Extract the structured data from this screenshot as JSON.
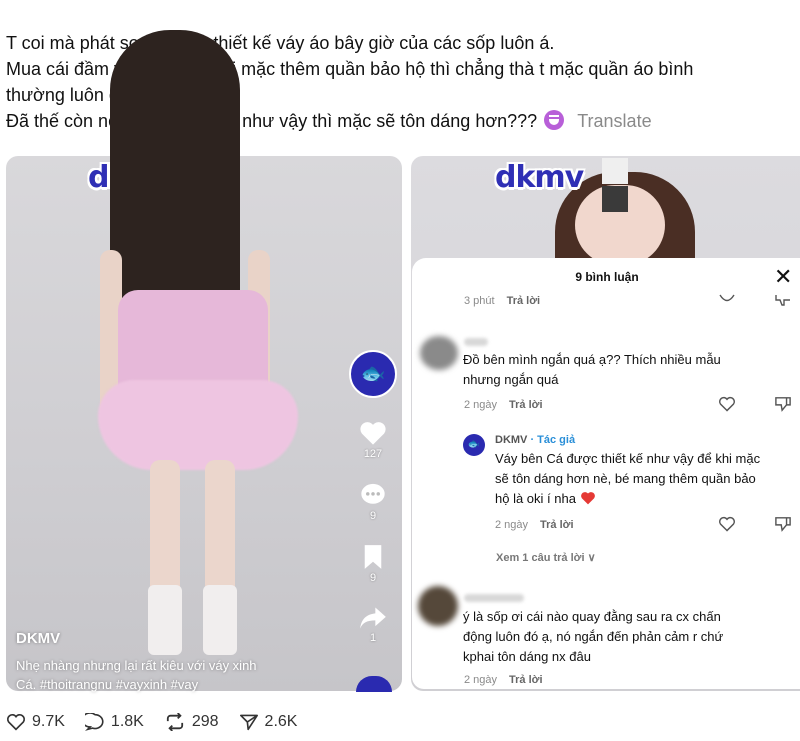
{
  "post": {
    "line1": "T coi mà phát sợ với kiểu thiết kế váy áo bây giờ của các sốp luôn á.",
    "line2": "Mua cái đầm về mà còn phải mặc thêm quần bảo hộ thì chẳng thà t mặc quần áo bình",
    "line3": "thường luôn cho xong.",
    "line4": "Đã thế còn nói là váy thiết kế như vậy thì mặc sẽ tôn dáng hơn???",
    "emoji": "laughing-purple-emoji",
    "translate": "Translate"
  },
  "left_video": {
    "logo": "dkmv",
    "likes": "127",
    "comments": "9",
    "saves": "9",
    "shares": "1",
    "author": "DKMV",
    "caption_line1": "Nhẹ nhàng nhưng lại rất kiêu với váy xinh",
    "caption_line2": "Cá. #thoitrangnu #vayxinh #vay"
  },
  "right_video": {
    "logo": "dkmv",
    "comments_title": "9 bình luận",
    "close": "✕",
    "comments": [
      {
        "time": "3 phút",
        "reply": "Trả lời"
      },
      {
        "text1": "Đồ bên mình ngắn quá ạ?? Thích nhiều mẫu",
        "text2": "nhưng ngắn quá",
        "time": "2 ngày",
        "reply": "Trả lời"
      },
      {
        "author": "DKMV",
        "author_tag": " · Tác giả",
        "text1": "Váy bên Cá được thiết kế như vậy để khi mặc",
        "text2": "sẽ tôn dáng hơn nè, bé mang thêm quần bảo",
        "text3": "hộ là oki í nha",
        "time": "2 ngày",
        "reply": "Trả lời"
      },
      {
        "text1": "ý là sốp ơi cái nào quay đằng sau ra cx chấn",
        "text2": "động luôn đó ạ, nó ngắn đến phản cảm r chứ",
        "text3": "kphai tôn dáng nx đâu",
        "time": "2 ngày",
        "reply": "Trả lời"
      }
    ],
    "more_replies": "Xem 1 câu trả lời ∨"
  },
  "stats": {
    "likes": "9.7K",
    "replies": "1.8K",
    "reposts": "298",
    "shares": "2.6K"
  },
  "colors": {
    "brand": "#2a2ab0",
    "heart_red": "#e53935",
    "text_gray": "#8a8a8a"
  }
}
